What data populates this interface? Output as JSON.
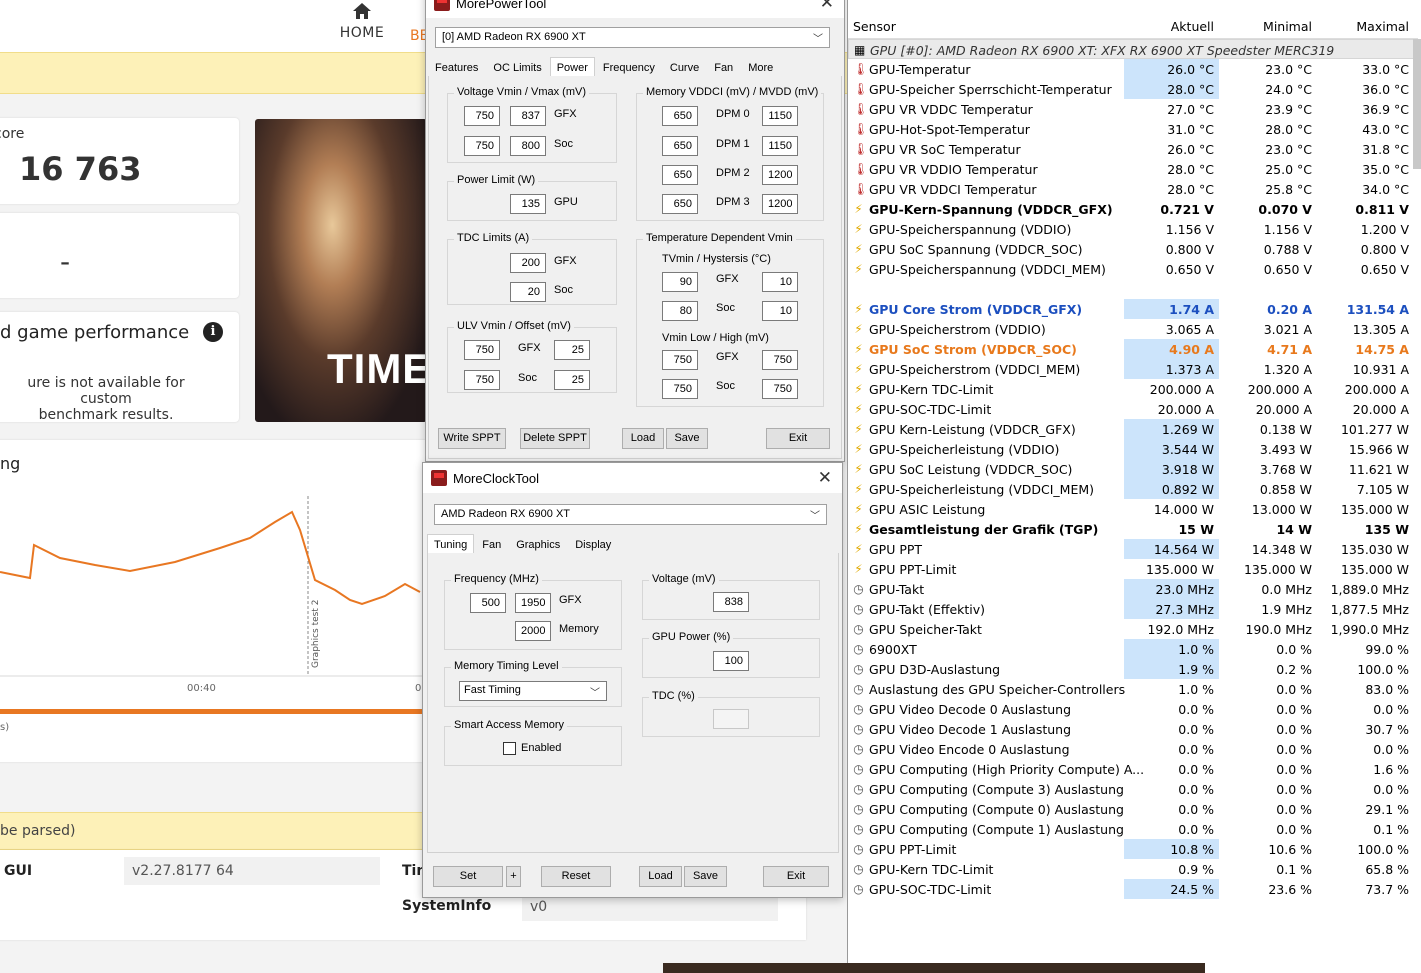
{
  "tdmark": {
    "nav_home": "HOME",
    "nav_be": "BE",
    "score_label": "core",
    "score_value": "16 763",
    "dash_value": "-",
    "perf_title": "d game performance",
    "perf_info": "i",
    "perf_msg_1": "ure is not available for custom",
    "perf_msg_2": "benchmark results.",
    "banner_text": "TIME",
    "chart_title": "ng",
    "parse_msg": "be parsed)",
    "gui_label": "GUI",
    "gui_value": "v2.27.8177 64",
    "tim_label": "Tin",
    "sysinfo_label": "SystemInfo",
    "sysinfo_value": "v0",
    "accent": "#e87722"
  },
  "chart_data": {
    "type": "line",
    "title": "",
    "x_ticks": [
      "00:40",
      "0"
    ],
    "x_unit_label": "s)",
    "annotation": "Graphics test 2",
    "points": [
      [
        0,
        572
      ],
      [
        30,
        578
      ],
      [
        34,
        545
      ],
      [
        60,
        558
      ],
      [
        95,
        565
      ],
      [
        130,
        571
      ],
      [
        175,
        562
      ],
      [
        220,
        548
      ],
      [
        250,
        538
      ],
      [
        275,
        522
      ],
      [
        292,
        512
      ],
      [
        300,
        530
      ],
      [
        315,
        580
      ],
      [
        335,
        590
      ],
      [
        350,
        600
      ],
      [
        362,
        604
      ],
      [
        385,
        596
      ],
      [
        405,
        584
      ],
      [
        420,
        592
      ]
    ]
  },
  "mpt": {
    "title": "MorePowerTool",
    "device": "[0] AMD Radeon RX 6900 XT",
    "tabs": [
      "Features",
      "OC Limits",
      "Power",
      "Frequency",
      "Curve",
      "Fan",
      "More"
    ],
    "active_tab": "Power",
    "voltage_group": "Voltage Vmin / Vmax (mV)",
    "gfx_vmin": "750",
    "gfx_vmax": "837",
    "gfx_label": "GFX",
    "soc_vmin": "750",
    "soc_vmax": "800",
    "soc_label": "Soc",
    "power_group": "Power Limit (W)",
    "power_val": "135",
    "power_label": "GPU",
    "tdc_group": "TDC Limits (A)",
    "tdc_gfx": "200",
    "tdc_gfx_label": "GFX",
    "tdc_soc": "20",
    "tdc_soc_label": "Soc",
    "ulv_group": "ULV Vmin / Offset (mV)",
    "ulv_gfx_min": "750",
    "ulv_gfx_off": "25",
    "ulv_gfx_label": "GFX",
    "ulv_soc_min": "750",
    "ulv_soc_off": "25",
    "ulv_soc_label": "Soc",
    "mem_group": "Memory VDDCI (mV) / MVDD (mV)",
    "dpm": [
      {
        "label": "DPM 0",
        "a": "650",
        "b": "1150"
      },
      {
        "label": "DPM 1",
        "a": "650",
        "b": "1150"
      },
      {
        "label": "DPM 2",
        "a": "650",
        "b": "1200"
      },
      {
        "label": "DPM 3",
        "a": "650",
        "b": "1200"
      }
    ],
    "tdv_group": "Temperature Dependent Vmin",
    "tvmin_label": "TVmin / Hystersis (°C)",
    "tv_gfx_a": "90",
    "tv_gfx_b": "10",
    "tv_gfx_label": "GFX",
    "tv_soc_a": "80",
    "tv_soc_b": "10",
    "tv_soc_label": "Soc",
    "vmin_label": "Vmin Low / High (mV)",
    "vm_gfx_a": "750",
    "vm_gfx_b": "750",
    "vm_gfx_label": "GFX",
    "vm_soc_a": "750",
    "vm_soc_b": "750",
    "vm_soc_label": "Soc",
    "btn_write": "Write SPPT",
    "btn_delete": "Delete SPPT",
    "btn_load": "Load",
    "btn_save": "Save",
    "btn_exit": "Exit"
  },
  "mct": {
    "title": "MoreClockTool",
    "device": "AMD Radeon RX 6900 XT",
    "tabs": [
      "Tuning",
      "Fan",
      "Graphics",
      "Display"
    ],
    "active_tab": "Tuning",
    "freq_group": "Frequency (MHz)",
    "freq_min": "500",
    "freq_max": "1950",
    "freq_gfx_label": "GFX",
    "freq_mem": "2000",
    "freq_mem_label": "Memory",
    "voltage_group": "Voltage (mV)",
    "voltage_val": "838",
    "power_group": "GPU Power (%)",
    "power_val": "100",
    "tdc_group": "TDC (%)",
    "tdc_val": "",
    "mtl_group": "Memory Timing Level",
    "mtl_val": "Fast Timing",
    "sam_group": "Smart Access Memory",
    "sam_label": "Enabled",
    "btn_set": "Set",
    "btn_plus": "+",
    "btn_reset": "Reset",
    "btn_load": "Load",
    "btn_save": "Save",
    "btn_exit": "Exit"
  },
  "hw": {
    "col_sensor": "Sensor",
    "col_current": "Aktuell",
    "col_min": "Minimal",
    "col_max": "Maximal",
    "rows": [
      {
        "t": "grp",
        "icon": "chip",
        "name": "GPU [#0]: AMD Radeon RX 6900 XT: XFX RX 6900 XT Speedster MERC319",
        "cur": "",
        "min": "",
        "max": ""
      },
      {
        "icon": "temp",
        "name": "GPU-Temperatur",
        "cur": "26.0 °C",
        "min": "23.0 °C",
        "max": "33.0 °C",
        "hl": true
      },
      {
        "icon": "temp",
        "name": "GPU-Speicher Sperrschicht-Temperatur",
        "cur": "28.0 °C",
        "min": "24.0 °C",
        "max": "36.0 °C",
        "hl": true
      },
      {
        "icon": "temp",
        "name": "GPU VR VDDC Temperatur",
        "cur": "27.0 °C",
        "min": "23.9 °C",
        "max": "36.9 °C"
      },
      {
        "icon": "temp",
        "name": "GPU-Hot-Spot-Temperatur",
        "cur": "31.0 °C",
        "min": "28.0 °C",
        "max": "43.0 °C"
      },
      {
        "icon": "temp",
        "name": "GPU VR SoC Temperatur",
        "cur": "26.0 °C",
        "min": "23.0 °C",
        "max": "31.8 °C"
      },
      {
        "icon": "temp",
        "name": "GPU VR VDDIO Temperatur",
        "cur": "28.0 °C",
        "min": "25.0 °C",
        "max": "35.0 °C"
      },
      {
        "icon": "temp",
        "name": "GPU VR VDDCI Temperatur",
        "cur": "28.0 °C",
        "min": "25.8 °C",
        "max": "34.0 °C"
      },
      {
        "t": "bold",
        "icon": "bolt",
        "name": "GPU-Kern-Spannung (VDDCR_GFX)",
        "cur": "0.721 V",
        "min": "0.070 V",
        "max": "0.811 V"
      },
      {
        "icon": "bolt",
        "name": "GPU-Speicherspannung (VDDIO)",
        "cur": "1.156 V",
        "min": "1.156 V",
        "max": "1.200 V"
      },
      {
        "icon": "bolt",
        "name": "GPU SoC Spannung (VDDCR_SOC)",
        "cur": "0.800 V",
        "min": "0.788 V",
        "max": "0.800 V"
      },
      {
        "icon": "bolt",
        "name": "GPU-Speicherspannung (VDDCI_MEM)",
        "cur": "0.650 V",
        "min": "0.650 V",
        "max": "0.650 V"
      },
      {
        "t": "empty",
        "icon": "",
        "name": "",
        "cur": "",
        "min": "",
        "max": ""
      },
      {
        "t": "blue",
        "icon": "bolt",
        "name": "GPU Core Strom (VDDCR_GFX)",
        "cur": "1.74 A",
        "min": "0.20 A",
        "max": "131.54 A",
        "hl": true
      },
      {
        "icon": "bolt",
        "name": "GPU-Speicherstrom (VDDIO)",
        "cur": "3.065 A",
        "min": "3.021 A",
        "max": "13.305 A"
      },
      {
        "t": "orange",
        "icon": "bolt",
        "name": "GPU SoC Strom (VDDCR_SOC)",
        "cur": "4.90 A",
        "min": "4.71 A",
        "max": "14.75 A",
        "hl": true
      },
      {
        "icon": "bolt",
        "name": "GPU-Speicherstrom (VDDCI_MEM)",
        "cur": "1.373 A",
        "min": "1.320 A",
        "max": "10.931 A",
        "hl": true
      },
      {
        "icon": "bolt",
        "name": "GPU-Kern TDC-Limit",
        "cur": "200.000 A",
        "min": "200.000 A",
        "max": "200.000 A"
      },
      {
        "icon": "bolt",
        "name": "GPU-SOC-TDC-Limit",
        "cur": "20.000 A",
        "min": "20.000 A",
        "max": "20.000 A"
      },
      {
        "icon": "bolt",
        "name": "GPU Kern-Leistung (VDDCR_GFX)",
        "cur": "1.269 W",
        "min": "0.138 W",
        "max": "101.277 W",
        "hl": true
      },
      {
        "icon": "bolt",
        "name": "GPU-Speicherleistung (VDDIO)",
        "cur": "3.544 W",
        "min": "3.493 W",
        "max": "15.966 W",
        "hl": true
      },
      {
        "icon": "bolt",
        "name": "GPU SoC Leistung (VDDCR_SOC)",
        "cur": "3.918 W",
        "min": "3.768 W",
        "max": "11.621 W",
        "hl": true
      },
      {
        "icon": "bolt",
        "name": "GPU-Speicherleistung (VDDCI_MEM)",
        "cur": "0.892 W",
        "min": "0.858 W",
        "max": "7.105 W",
        "hl": true
      },
      {
        "icon": "bolt",
        "name": "GPU ASIC Leistung",
        "cur": "14.000 W",
        "min": "13.000 W",
        "max": "135.000 W"
      },
      {
        "t": "bold",
        "icon": "bolt",
        "name": "Gesamtleistung der Grafik (TGP)",
        "cur": "15 W",
        "min": "14 W",
        "max": "135 W"
      },
      {
        "icon": "bolt",
        "name": "GPU PPT",
        "cur": "14.564 W",
        "min": "14.348 W",
        "max": "135.030 W",
        "hl": true
      },
      {
        "icon": "bolt",
        "name": "GPU PPT-Limit",
        "cur": "135.000 W",
        "min": "135.000 W",
        "max": "135.000 W"
      },
      {
        "icon": "clock",
        "name": "GPU-Takt",
        "cur": "23.0 MHz",
        "min": "0.0 MHz",
        "max": "1,889.0 MHz",
        "hl": true
      },
      {
        "icon": "clock",
        "name": "GPU-Takt (Effektiv)",
        "cur": "27.3 MHz",
        "min": "1.9 MHz",
        "max": "1,877.5 MHz",
        "hl": true
      },
      {
        "icon": "clock",
        "name": "GPU Speicher-Takt",
        "cur": "192.0 MHz",
        "min": "190.0 MHz",
        "max": "1,990.0 MHz"
      },
      {
        "icon": "clock",
        "name": "6900XT",
        "cur": "1.0 %",
        "min": "0.0 %",
        "max": "99.0 %",
        "hl": true
      },
      {
        "icon": "clock",
        "name": "GPU D3D-Auslastung",
        "cur": "1.9 %",
        "min": "0.2 %",
        "max": "100.0 %",
        "hl": true
      },
      {
        "icon": "clock",
        "name": "Auslastung des GPU Speicher-Controllers",
        "cur": "1.0 %",
        "min": "0.0 %",
        "max": "83.0 %"
      },
      {
        "icon": "clock",
        "name": "GPU Video Decode 0 Auslastung",
        "cur": "0.0 %",
        "min": "0.0 %",
        "max": "0.0 %"
      },
      {
        "icon": "clock",
        "name": "GPU Video Decode 1 Auslastung",
        "cur": "0.0 %",
        "min": "0.0 %",
        "max": "30.7 %"
      },
      {
        "icon": "clock",
        "name": "GPU Video Encode 0 Auslastung",
        "cur": "0.0 %",
        "min": "0.0 %",
        "max": "0.0 %"
      },
      {
        "icon": "clock",
        "name": "GPU Computing (High Priority Compute) A...",
        "cur": "0.0 %",
        "min": "0.0 %",
        "max": "1.6 %"
      },
      {
        "icon": "clock",
        "name": "GPU Computing (Compute 3) Auslastung",
        "cur": "0.0 %",
        "min": "0.0 %",
        "max": "0.0 %"
      },
      {
        "icon": "clock",
        "name": "GPU Computing (Compute 0) Auslastung",
        "cur": "0.0 %",
        "min": "0.0 %",
        "max": "29.1 %"
      },
      {
        "icon": "clock",
        "name": "GPU Computing (Compute 1) Auslastung",
        "cur": "0.0 %",
        "min": "0.0 %",
        "max": "0.1 %"
      },
      {
        "icon": "clock",
        "name": "GPU PPT-Limit",
        "cur": "10.8 %",
        "min": "10.6 %",
        "max": "100.0 %",
        "hl": true
      },
      {
        "icon": "clock",
        "name": "GPU-Kern TDC-Limit",
        "cur": "0.9 %",
        "min": "0.1 %",
        "max": "65.8 %"
      },
      {
        "icon": "clock",
        "name": "GPU-SOC-TDC-Limit",
        "cur": "24.5 %",
        "min": "23.6 %",
        "max": "73.7 %",
        "hl": true
      }
    ]
  }
}
